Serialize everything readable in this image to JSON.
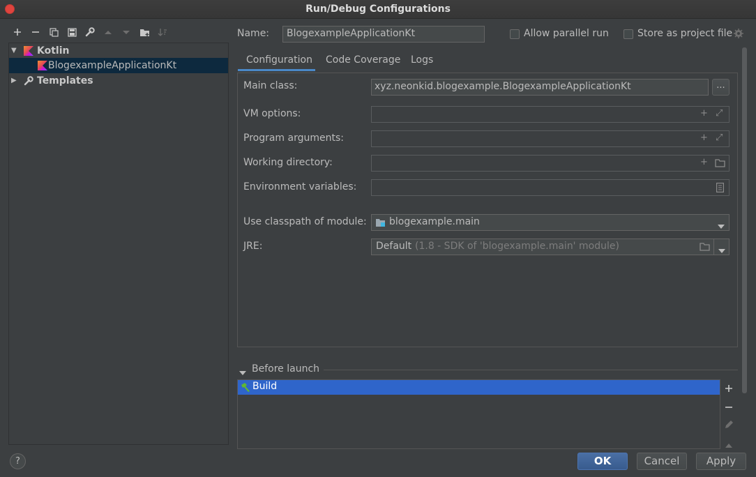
{
  "window": {
    "title": "Run/Debug Configurations"
  },
  "toolbar": {
    "icons": [
      "plus-icon",
      "minus-icon",
      "copy-icon",
      "save-icon",
      "wrench-icon",
      "arrow-up-icon",
      "arrow-down-icon",
      "folder-add-icon",
      "sort-icon"
    ]
  },
  "tree": {
    "kotlin_label": "Kotlin",
    "config_label": "BlogexampleApplicationKt",
    "templates_label": "Templates"
  },
  "name_row": {
    "label": "Name:",
    "value": "BlogexampleApplicationKt",
    "allow_parallel": "Allow parallel run",
    "store_as_project": "Store as project file"
  },
  "tabs": [
    "Configuration",
    "Code Coverage",
    "Logs"
  ],
  "config": {
    "main_class_label": "Main class:",
    "main_class_value": "xyz.neonkid.blogexample.BlogexampleApplicationKt",
    "browse_label": "...",
    "vm_options_label": "VM options:",
    "program_args_label": "Program arguments:",
    "working_dir_label": "Working directory:",
    "env_vars_label": "Environment variables:",
    "classpath_label": "Use classpath of module:",
    "classpath_value": "blogexample.main",
    "jre_label": "JRE:",
    "jre_value": "Default",
    "jre_hint": "(1.8 - SDK of 'blogexample.main' module)"
  },
  "before_launch": {
    "label": "Before launch",
    "items": [
      "Build"
    ]
  },
  "footer": {
    "help": "?",
    "ok": "OK",
    "cancel": "Cancel",
    "apply": "Apply"
  },
  "colors": {
    "background": "#3c3f41",
    "selection": "#0d293e",
    "list_selection": "#2f65ca",
    "kotlin_accent": "#7f52ff"
  }
}
